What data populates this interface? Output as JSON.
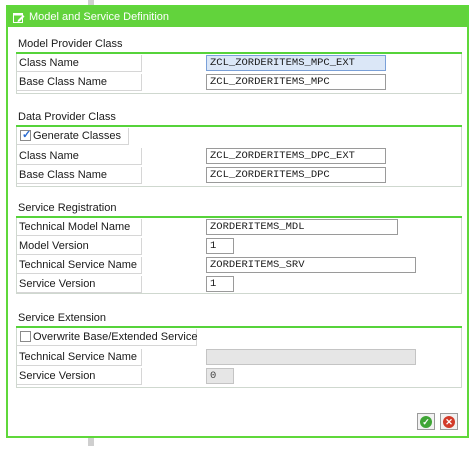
{
  "window": {
    "title": "Model and Service Definition"
  },
  "model_provider_class": {
    "header": "Model Provider Class",
    "class_name_label": "Class Name",
    "class_name_value": "ZCL_ZORDERITEMS_MPC_EXT",
    "base_class_label": "Base Class Name",
    "base_class_value": "ZCL_ZORDERITEMS_MPC"
  },
  "data_provider_class": {
    "header": "Data Provider Class",
    "generate_label": "Generate Classes",
    "generate_checked": true,
    "class_name_label": "Class Name",
    "class_name_value": "ZCL_ZORDERITEMS_DPC_EXT",
    "base_class_label": "Base Class Name",
    "base_class_value": "ZCL_ZORDERITEMS_DPC"
  },
  "service_registration": {
    "header": "Service Registration",
    "tech_model_label": "Technical Model Name",
    "tech_model_value": "ZORDERITEMS_MDL",
    "model_version_label": "Model Version",
    "model_version_value": "1",
    "tech_service_label": "Technical Service Name",
    "tech_service_value": "ZORDERITEMS_SRV",
    "service_version_label": "Service Version",
    "service_version_value": "1"
  },
  "service_extension": {
    "header": "Service Extension",
    "overwrite_label": "Overwrite Base/Extended Service",
    "overwrite_checked": false,
    "tech_service_label": "Technical Service Name",
    "tech_service_value": "",
    "service_version_label": "Service Version",
    "service_version_value": "0"
  },
  "buttons": {
    "ok_icon": "check-icon",
    "cancel_icon": "cancel-icon"
  },
  "colors": {
    "accent": "#62d33c",
    "ok": "#3fa535",
    "cancel": "#d23b2a"
  }
}
